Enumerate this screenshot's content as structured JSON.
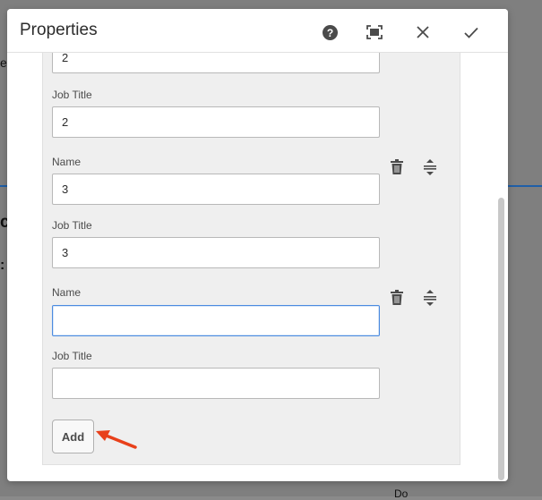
{
  "dialog": {
    "title": "Properties",
    "header_icons": [
      "help-icon",
      "fullscreen-icon",
      "close-icon",
      "check-icon"
    ]
  },
  "fields": [
    {
      "label": "Job Title",
      "value": "2"
    },
    {
      "label": "Name",
      "value": "3"
    },
    {
      "label": "Job Title",
      "value": "3"
    },
    {
      "label": "Name",
      "value": ""
    },
    {
      "label": "Job Title",
      "value": ""
    }
  ],
  "partial_top_value": "2",
  "add_label": "Add",
  "background": {
    "fragment_1": "e",
    "fragment_2": "c",
    "fragment_3": ":",
    "footer_text": "Do"
  },
  "colors": {
    "focus_border": "#4b8be0",
    "arrow": "#e8401a",
    "background_rule": "#1f5fa8"
  }
}
